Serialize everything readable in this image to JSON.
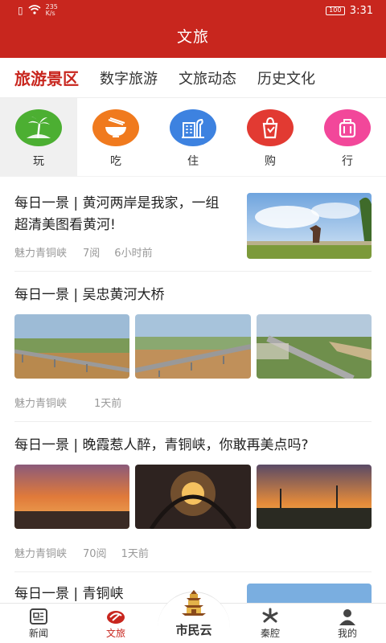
{
  "status": {
    "speed_top": "235",
    "speed_unit": "K/s",
    "battery": "100",
    "time": "3:31"
  },
  "header": {
    "title": "文旅"
  },
  "tabs": [
    "旅游景区",
    "数字旅游",
    "文旅动态",
    "历史文化"
  ],
  "quick": [
    {
      "label": "玩",
      "icon": "palm-tree-icon",
      "color": "#4caf32"
    },
    {
      "label": "吃",
      "icon": "food-bowl-icon",
      "color": "#f07a1e"
    },
    {
      "label": "住",
      "icon": "hotel-icon",
      "color": "#3d82e0"
    },
    {
      "label": "购",
      "icon": "shopping-bag-icon",
      "color": "#e23a32"
    },
    {
      "label": "行",
      "icon": "luggage-icon",
      "color": "#f2479a"
    }
  ],
  "feed": {
    "item1": {
      "title": "每日一景 | 黄河两岸是我家，一组超清美图看黄河!",
      "source": "魅力青铜峡",
      "reads": "7阅",
      "time": "6小时前"
    },
    "item2": {
      "title": "每日一景 | 吴忠黄河大桥",
      "source": "魅力青铜峡",
      "time": "1天前"
    },
    "item3": {
      "title": "每日一景 | 晚霞惹人醉，青铜峡，你敢再美点吗?",
      "source": "魅力青铜峡",
      "reads": "70阅",
      "time": "1天前"
    },
    "item4": {
      "title": "每日一景 | 青铜峡"
    }
  },
  "nav": {
    "news": "新闻",
    "culture": "文旅",
    "brand": "市民云",
    "opera": "秦腔",
    "mine": "我的"
  }
}
